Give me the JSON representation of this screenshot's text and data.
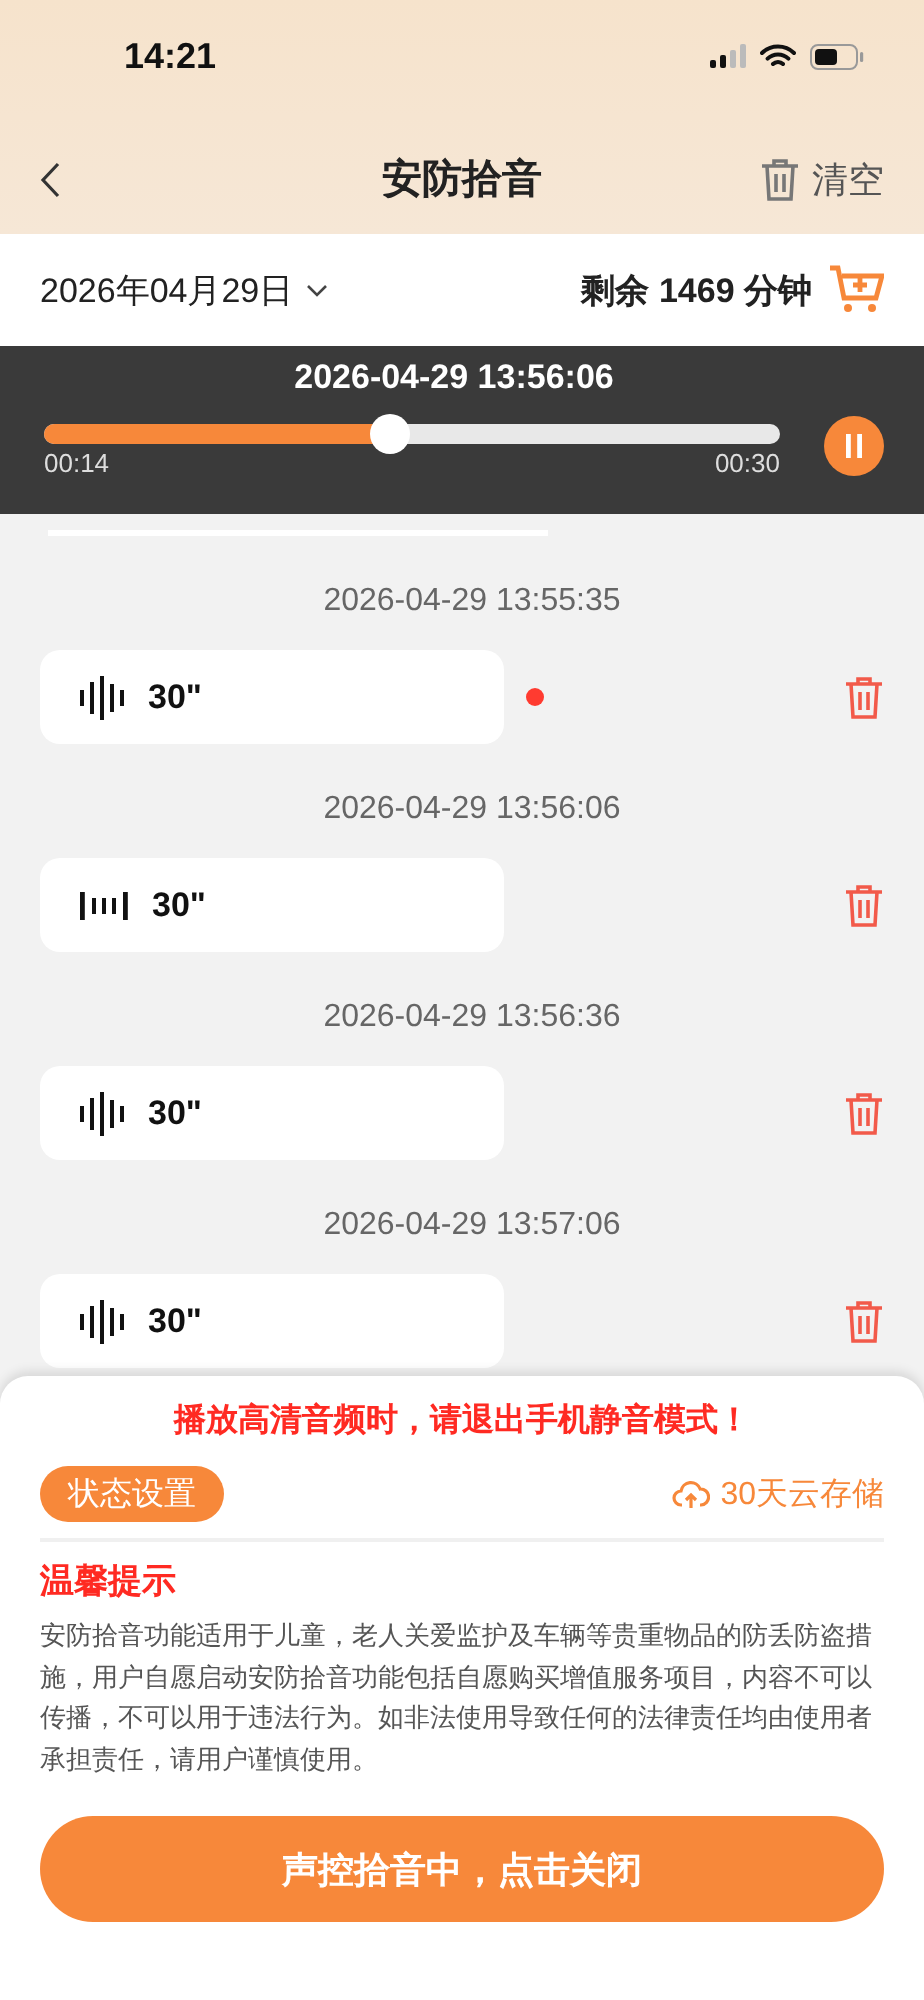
{
  "status_bar": {
    "time": "14:21"
  },
  "header": {
    "title": "安防拾音",
    "clear_label": "清空"
  },
  "date_bar": {
    "date": "2026年04月29日",
    "remaining": "剩余 1469 分钟"
  },
  "player": {
    "title": "2026-04-29 13:56:06",
    "elapsed": "00:14",
    "total": "00:30",
    "level": 0.47,
    "playing": true
  },
  "records": [
    {
      "time": "2026-04-29 13:55:35",
      "duration": "30\"",
      "unread": true,
      "playing": false
    },
    {
      "time": "2026-04-29 13:56:06",
      "duration": "30\"",
      "unread": false,
      "playing": true
    },
    {
      "time": "2026-04-29 13:56:36",
      "duration": "30\"",
      "unread": false,
      "playing": false
    },
    {
      "time": "2026-04-29 13:57:06",
      "duration": "30\"",
      "unread": false,
      "playing": false
    }
  ],
  "sheet": {
    "warning": "播放高清音频时，请退出手机静音模式！",
    "status_button": "状态设置",
    "cloud": "30天云存储",
    "notice_title": "温馨提示",
    "notice": "安防拾音功能适用于儿童，老人关爱监护及车辆等贵重物品的防丢防盗措施，用户自愿启动安防拾音功能包括自愿购买增值服务项目，内容不可以传播，不可以用于违法行为。如非法使用导致任何的法律责任均由使用者承担责任，请用户谨慎使用。",
    "main_button": "声控拾音中，点击关闭"
  }
}
